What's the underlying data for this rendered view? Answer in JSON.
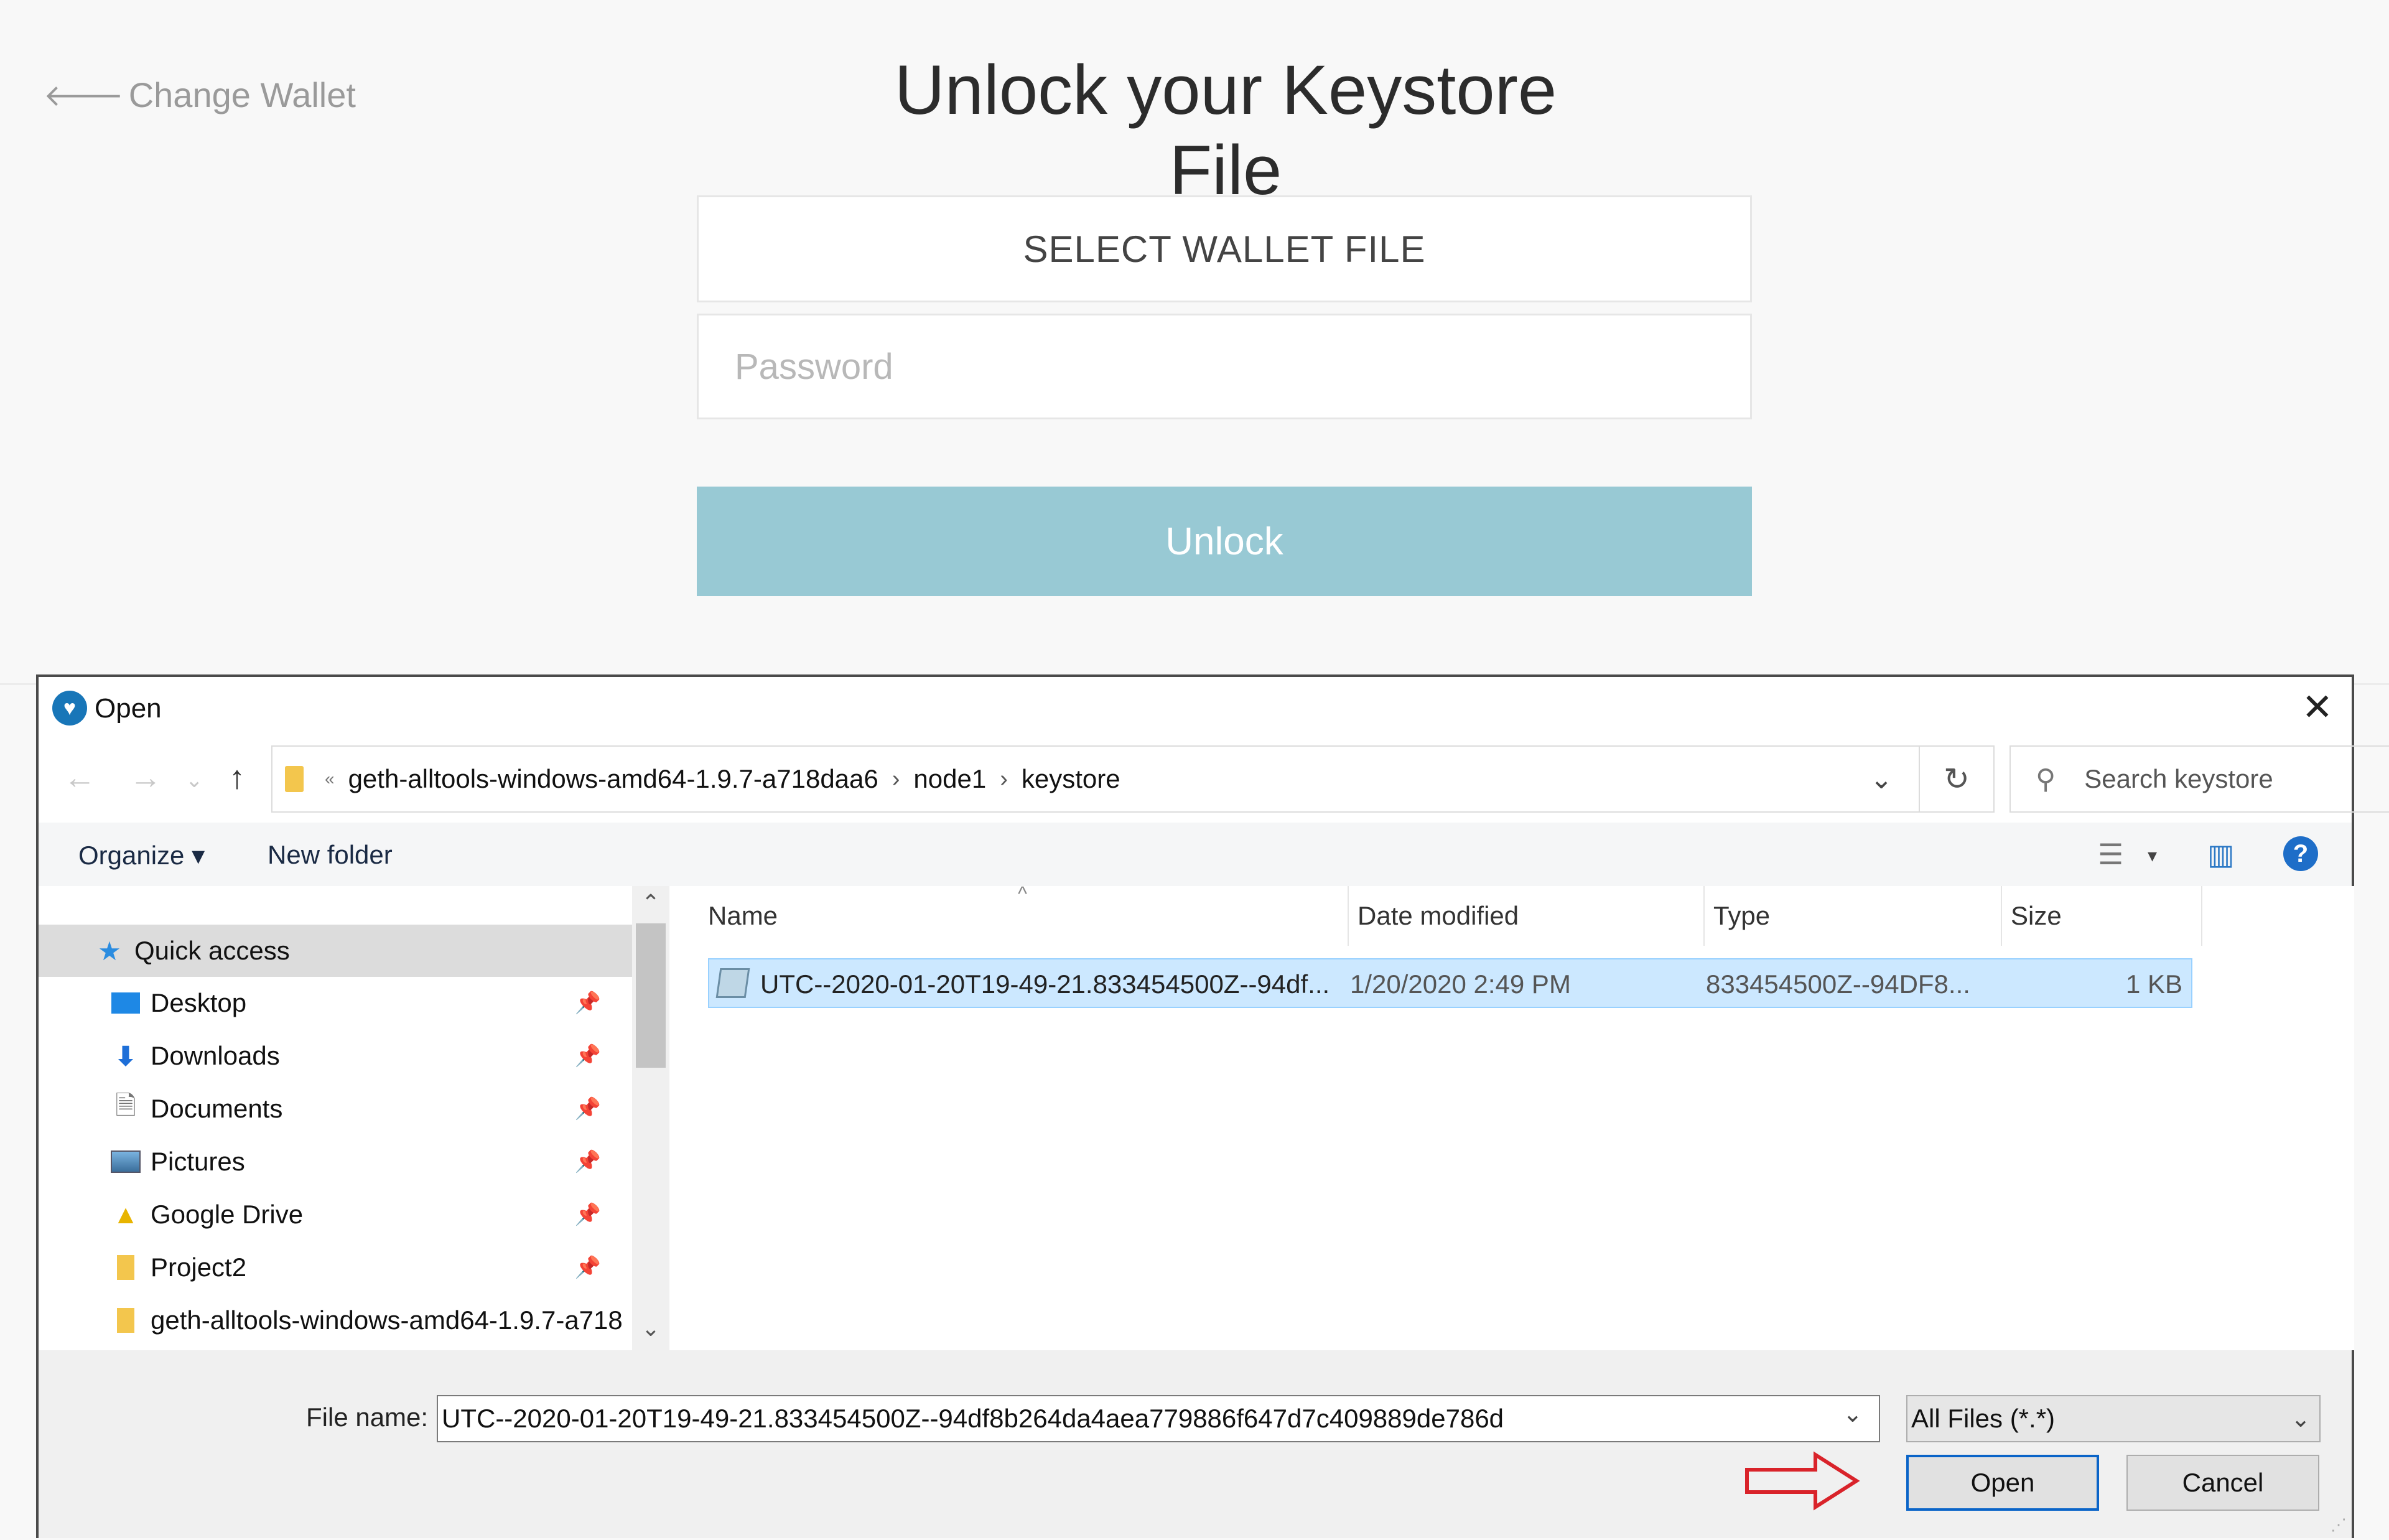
{
  "web": {
    "back_label": "Change Wallet",
    "title": "Unlock your Keystore File",
    "select_file_label": "SELECT WALLET FILE",
    "password_placeholder": "Password",
    "unlock_label": "Unlock",
    "accent_color": "#98c9d4"
  },
  "dialog": {
    "title": "Open",
    "address": {
      "overflow_marker": "«",
      "crumbs": [
        "geth-alltools-windows-amd64-1.9.7-a718daa6",
        "node1",
        "keystore"
      ]
    },
    "search_placeholder": "Search keystore",
    "toolbar": {
      "organize": "Organize ▾",
      "new_folder": "New folder"
    },
    "nav": {
      "quick_access": "Quick access",
      "items": [
        "Desktop",
        "Downloads",
        "Documents",
        "Pictures",
        "Google Drive",
        "Project2",
        "geth-alltools-windows-amd64-1.9.7-a718"
      ]
    },
    "columns": {
      "name": "Name",
      "date": "Date modified",
      "type": "Type",
      "size": "Size"
    },
    "file": {
      "name": "UTC--2020-01-20T19-49-21.833454500Z--94df...",
      "date": "1/20/2020 2:49 PM",
      "type": "833454500Z--94DF8...",
      "size": "1 KB"
    },
    "filename_label": "File name:",
    "filename_value": "UTC--2020-01-20T19-49-21.833454500Z--94df8b264da4aea779886f647d7c409889de786d",
    "filetype_value": "All Files (*.*)",
    "open_label": "Open",
    "cancel_label": "Cancel",
    "selection_color": "#cce8ff",
    "hint_arrow_color": "#d9232a"
  }
}
